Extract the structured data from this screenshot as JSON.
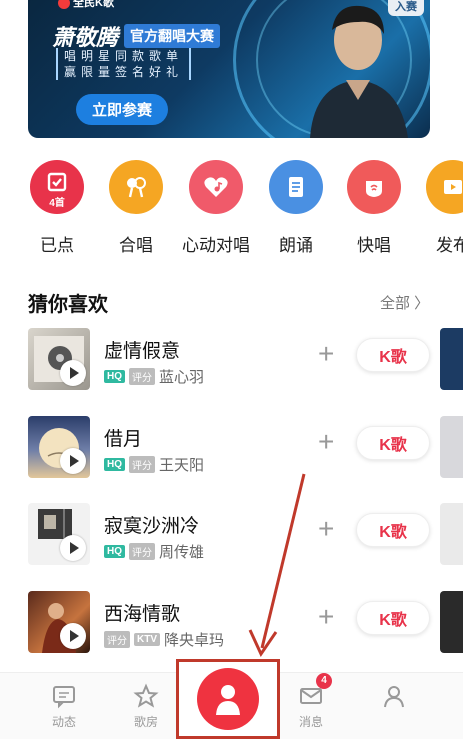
{
  "banner": {
    "app_logo": "全民K歌",
    "top_badge": "入赛",
    "artist": "萧敬腾",
    "event_tag": "官方翻唱大赛",
    "slogan_line1": "唱明星同款歌单",
    "slogan_line2": "赢限量签名好礼",
    "cta": "立即参赛"
  },
  "actions": [
    {
      "label": "已点",
      "count": "4首",
      "color": "#e8334a",
      "icon": "check-list-icon"
    },
    {
      "label": "合唱",
      "color": "#f5a623",
      "icon": "duet-mic-icon"
    },
    {
      "label": "心动对唱",
      "color": "#f05a6a",
      "icon": "heart-music-icon"
    },
    {
      "label": "朗诵",
      "color": "#4a90e2",
      "icon": "document-icon"
    },
    {
      "label": "快唱",
      "color": "#f05a5a",
      "icon": "quick-sing-icon"
    },
    {
      "label": "发布",
      "color": "#f5a623",
      "icon": "publish-icon"
    }
  ],
  "section": {
    "title": "猜你喜欢",
    "more": "全部 〉"
  },
  "songs": [
    {
      "title": "虚情假意",
      "tags": [
        "HQ",
        "评分"
      ],
      "artist": "蓝心羽",
      "k_label": "K歌"
    },
    {
      "title": "借月",
      "tags": [
        "HQ",
        "评分"
      ],
      "artist": "王天阳",
      "k_label": "K歌"
    },
    {
      "title": "寂寞沙洲冷",
      "tags": [
        "HQ",
        "评分"
      ],
      "artist": "周传雄",
      "k_label": "K歌"
    },
    {
      "title": "西海情歌",
      "tags": [
        "评分",
        "KTV"
      ],
      "artist": "降央卓玛",
      "k_label": "K歌"
    }
  ],
  "nav": {
    "feed": "动态",
    "room": "歌房",
    "messages": "消息",
    "messages_badge": "4",
    "me": ""
  },
  "colors": {
    "accent": "#e8334a",
    "hq_tag": "#2fb9a0",
    "annotation": "#c0392b"
  }
}
